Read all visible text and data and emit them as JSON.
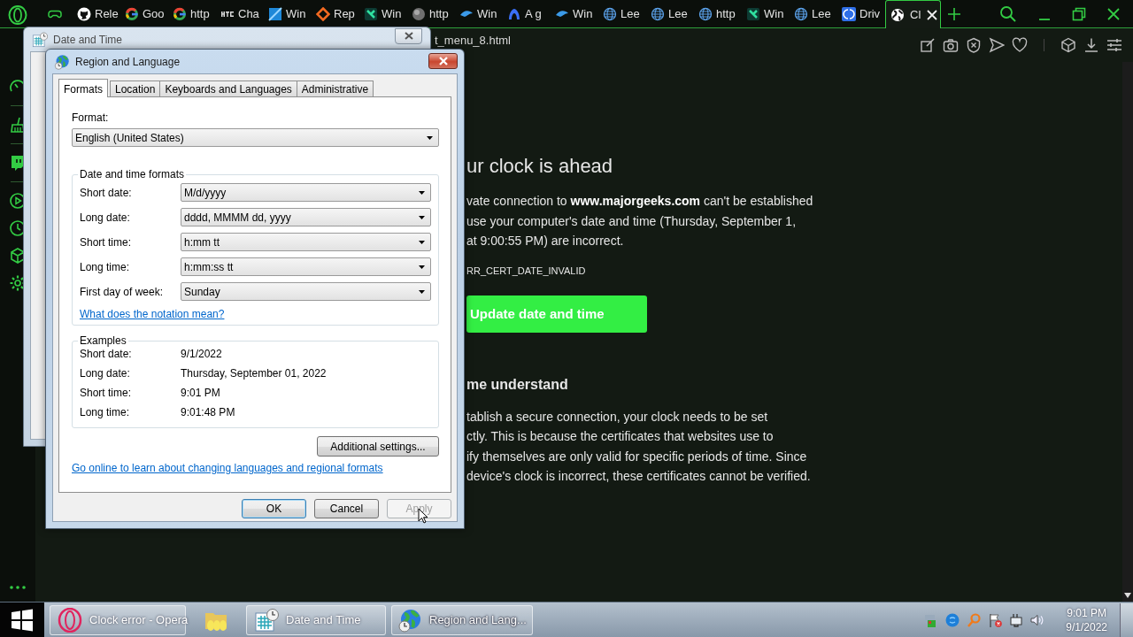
{
  "browser": {
    "tabs": [
      {
        "kind": "gamepad",
        "selected": false
      },
      {
        "kind": "github",
        "label": "Rele",
        "selected": false
      },
      {
        "kind": "google",
        "label": "Goo",
        "selected": false
      },
      {
        "kind": "google",
        "label": "http",
        "selected": false
      },
      {
        "kind": "htg",
        "label": "Cha",
        "selected": false
      },
      {
        "kind": "windows",
        "label": "Win",
        "selected": false
      },
      {
        "kind": "redirect",
        "label": "Rep",
        "selected": false
      },
      {
        "kind": "bolt",
        "label": "Win",
        "selected": false
      },
      {
        "kind": "sphere",
        "label": "http",
        "selected": false
      },
      {
        "kind": "bird",
        "label": "Win",
        "selected": false
      },
      {
        "kind": "arch",
        "label": "A g",
        "selected": false
      },
      {
        "kind": "bird",
        "label": "Win",
        "selected": false
      },
      {
        "kind": "globe",
        "label": "Lee",
        "selected": false
      },
      {
        "kind": "globe",
        "label": "Lee",
        "selected": false
      },
      {
        "kind": "globe",
        "label": "http",
        "selected": false
      },
      {
        "kind": "bolt",
        "label": "Win",
        "selected": false
      },
      {
        "kind": "globe",
        "label": "Lee",
        "selected": false
      },
      {
        "kind": "drive",
        "label": "Driv",
        "selected": false
      },
      {
        "kind": "earth",
        "label": "Cl",
        "selected": true
      }
    ],
    "address_bar": {
      "url": "t_menu_8.html"
    },
    "page": {
      "heading": "ur clock is ahead",
      "message": "vate connection to **www.majorgeeks.com** can't be established\nuse your computer's date and time (Thursday, September 1,\n at 9:00:55 PM) are incorrect.",
      "error_code": "RR_CERT_DATE_INVALID",
      "button": "Update date and time",
      "subheading": "me understand",
      "explanation": "tablish a secure connection, your clock needs to be set\nctly. This is because the certificates that websites use to\nify themselves are only valid for specific periods of time. Since\ndevice's clock is incorrect, these certificates cannot be verified."
    }
  },
  "date_time_window": {
    "title": "Date and Time"
  },
  "region_dialog": {
    "title": "Region and Language",
    "tabs": [
      {
        "label": "Formats",
        "selected": true
      },
      {
        "label": "Location",
        "selected": false
      },
      {
        "label": "Keyboards and Languages",
        "selected": false
      },
      {
        "label": "Administrative",
        "selected": false
      }
    ],
    "format_label": "Format:",
    "format_value": "English (United States)",
    "formats_group": {
      "title": "Date and time formats",
      "rows": [
        {
          "label": "Short date:",
          "value": "M/d/yyyy"
        },
        {
          "label": "Long date:",
          "value": "dddd, MMMM dd, yyyy"
        },
        {
          "label": "Short time:",
          "value": "h:mm tt"
        },
        {
          "label": "Long time:",
          "value": "h:mm:ss tt"
        },
        {
          "label": "First day of week:",
          "value": "Sunday"
        }
      ]
    },
    "notation_link": "What does the notation mean?",
    "examples_group": {
      "title": "Examples",
      "rows": [
        {
          "label": "Short date:",
          "value": "9/1/2022"
        },
        {
          "label": "Long date:",
          "value": "Thursday, September 01, 2022"
        },
        {
          "label": "Short time:",
          "value": "9:01 PM"
        },
        {
          "label": "Long time:",
          "value": "9:01:48 PM"
        }
      ]
    },
    "additional_button": "Additional settings...",
    "online_link": "Go online to learn about changing languages and regional formats",
    "buttons": [
      {
        "label": "OK",
        "default": true,
        "disabled": false
      },
      {
        "label": "Cancel",
        "default": false,
        "disabled": false
      },
      {
        "label": "Apply",
        "default": false,
        "disabled": true
      }
    ]
  },
  "taskbar": {
    "items": [
      {
        "kind": "opera",
        "label": "Clock error - Opera",
        "selected": false
      },
      {
        "kind": "folder",
        "selected": false
      },
      {
        "kind": "calendar",
        "label": "Date and Time",
        "selected": false
      },
      {
        "kind": "globe",
        "label": "Region and Lang...",
        "selected": true
      }
    ],
    "clock": {
      "time": "9:01 PM",
      "date": "9/1/2022"
    }
  }
}
